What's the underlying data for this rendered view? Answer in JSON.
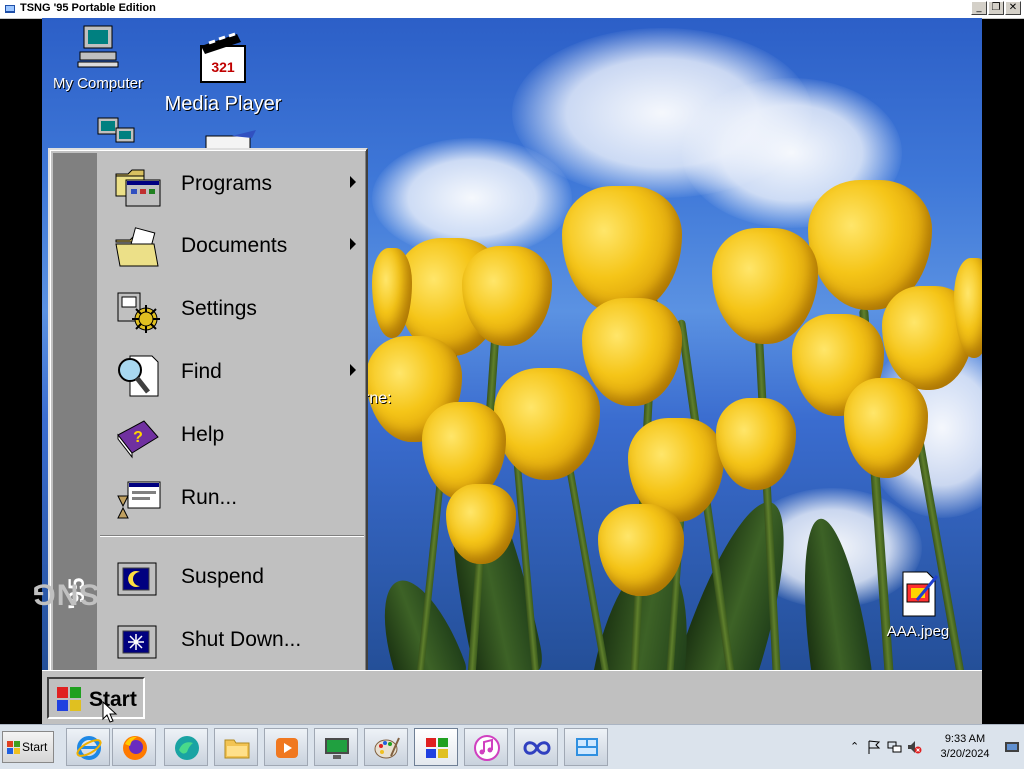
{
  "host_window": {
    "title": "TSNG '95 Portable Edition",
    "controls": {
      "minimize": "_",
      "restore": "❐",
      "close": "✕"
    }
  },
  "desktop": {
    "icons": [
      {
        "label": "My Computer",
        "icon": "my-computer-icon"
      },
      {
        "label": "Media Player",
        "icon": "media-player-icon"
      },
      {
        "label": "AAA.jpeg",
        "icon": "jpeg-file-icon"
      }
    ],
    "partial_text": "rne:"
  },
  "start_menu": {
    "brand": {
      "main": "TSNG",
      "suffix": "'95"
    },
    "items": [
      {
        "label": "Programs",
        "icon": "programs-folder-icon",
        "submenu": true
      },
      {
        "label": "Documents",
        "icon": "documents-folder-icon",
        "submenu": true
      },
      {
        "label": "Settings",
        "icon": "settings-icon",
        "submenu": false
      },
      {
        "label": "Find",
        "icon": "find-icon",
        "submenu": true
      },
      {
        "label": "Help",
        "icon": "help-book-icon",
        "submenu": false
      },
      {
        "label": "Run...",
        "icon": "run-icon",
        "submenu": false
      },
      {
        "label": "Suspend",
        "icon": "suspend-icon",
        "submenu": false
      },
      {
        "label": "Shut Down...",
        "icon": "shutdown-icon",
        "submenu": false
      }
    ]
  },
  "emu_taskbar": {
    "start_label": "Start"
  },
  "host_taskbar": {
    "start_label": "Start",
    "apps": [
      {
        "name": "internet-explorer-icon"
      },
      {
        "name": "firefox-icon"
      },
      {
        "name": "edge-icon"
      },
      {
        "name": "file-explorer-icon"
      },
      {
        "name": "media-player-icon"
      },
      {
        "name": "monitor-app-icon"
      },
      {
        "name": "paint-icon"
      },
      {
        "name": "tsng95-icon"
      },
      {
        "name": "itunes-icon"
      },
      {
        "name": "infinity-app-icon"
      },
      {
        "name": "control-panel-icon"
      }
    ],
    "active_app": "tsng95-icon",
    "clock": {
      "time": "9:33 AM",
      "date": "3/20/2024"
    }
  },
  "colors": {
    "win95_gray": "#c0c0c0",
    "brand_bar": "#808080",
    "sky": "#3f78d8",
    "tulip": "#f5c518"
  }
}
